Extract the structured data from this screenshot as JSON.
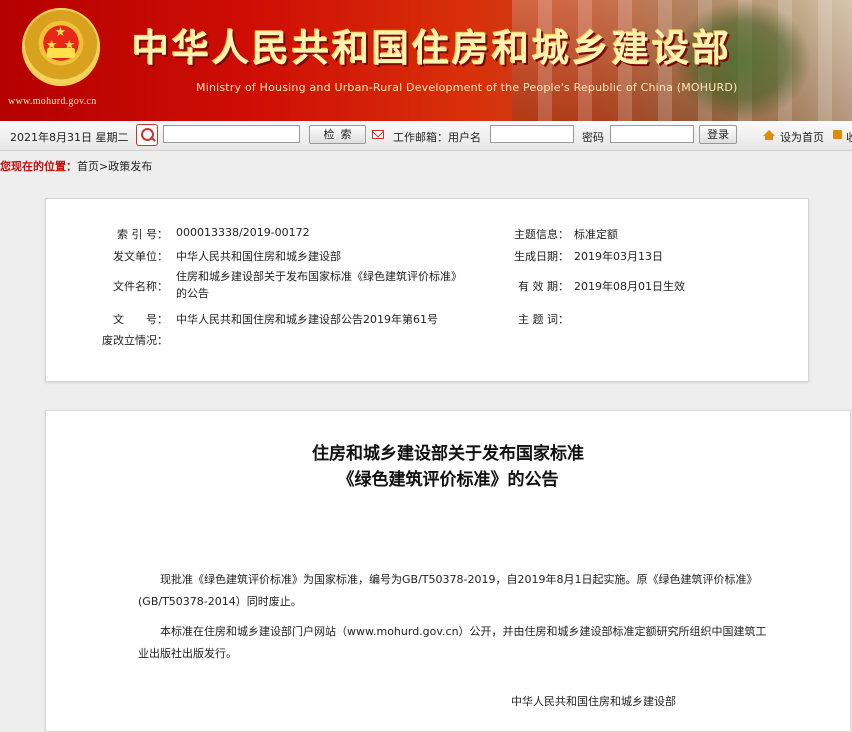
{
  "header": {
    "site_title": "中华人民共和国住房和城乡建设部",
    "site_subtitle": "Ministry of Housing and Urban-Rural Development of the People's Republic of China (MOHURD)",
    "site_url": "www.mohurd.gov.cn"
  },
  "toolbar": {
    "date": "2021年8月31日  星期二",
    "search_input_value": "",
    "search_button": "检索",
    "mail_label": "工作邮箱：用户名",
    "username_value": "",
    "password_label": "密码",
    "password_value": "",
    "login_button": "登录",
    "home_link": "设为首页",
    "fav_link": "收"
  },
  "breadcrumb": {
    "label": "您现在的位置：",
    "path": "首页>政策发布"
  },
  "info": {
    "index_label": "索 引 号：",
    "index_value": "000013338/2019-00172",
    "issuer_label": "发文单位：",
    "issuer_value": "中华人民共和国住房和城乡建设部",
    "filename_label": "文件名称：",
    "filename_value": "住房和城乡建设部关于发布国家标准《绿色建筑评价标准》的公告",
    "docno_label": "文　　号：",
    "docno_value": "中华人民共和国住房和城乡建设部公告2019年第61号",
    "revoke_label": "废改立情况：",
    "revoke_value": "",
    "topic_label": "主题信息：",
    "topic_value": "标准定额",
    "gendate_label": "生成日期：",
    "gendate_value": "2019年03月13日",
    "validity_label": "有 效 期：",
    "validity_value": "2019年08月01日生效",
    "keywords_label": "主 题 词：",
    "keywords_value": ""
  },
  "document": {
    "title_line1": "住房和城乡建设部关于发布国家标准",
    "title_line2": "《绿色建筑评价标准》的公告",
    "paragraph1": "现批准《绿色建筑评价标准》为国家标准，编号为GB/T50378-2019，自2019年8月1日起实施。原《绿色建筑评价标准》(GB/T50378-2014）同时废止。",
    "paragraph2": "本标准在住房和城乡建设部门户网站（www.mohurd.gov.cn）公开，并由住房和城乡建设部标准定额研究所组织中国建筑工业出版社出版发行。",
    "signature": "中华人民共和国住房和城乡建设部"
  },
  "colors": {
    "banner_red": "#cf0e05",
    "title_gold": "#fff3b0",
    "breadcrumb_red": "#c01010"
  }
}
